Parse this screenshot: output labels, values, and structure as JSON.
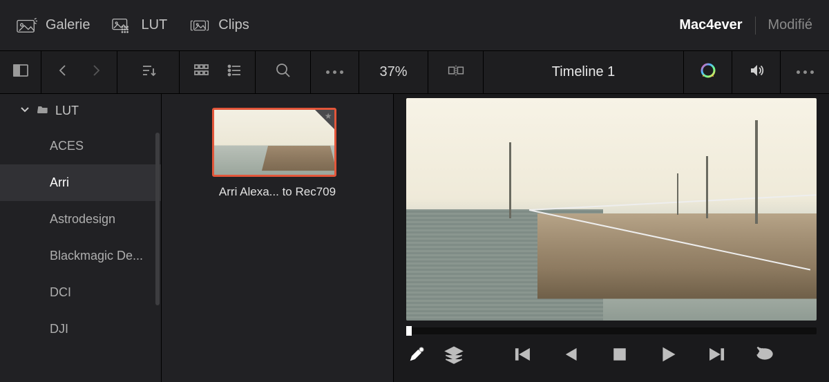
{
  "top_tabs": {
    "gallery": "Galerie",
    "lut": "LUT",
    "clips": "Clips"
  },
  "project": {
    "name": "Mac4ever",
    "modified": "Modifié"
  },
  "toolbar2": {
    "zoom": "37%",
    "timeline_name": "Timeline 1"
  },
  "sidebar": {
    "root_label": "LUT",
    "items": [
      "ACES",
      "Arri",
      "Astrodesign",
      "Blackmagic De...",
      "DCI",
      "DJI"
    ],
    "active_index": 1
  },
  "grid": {
    "thumb_label": "Arri Alexa... to Rec709"
  }
}
